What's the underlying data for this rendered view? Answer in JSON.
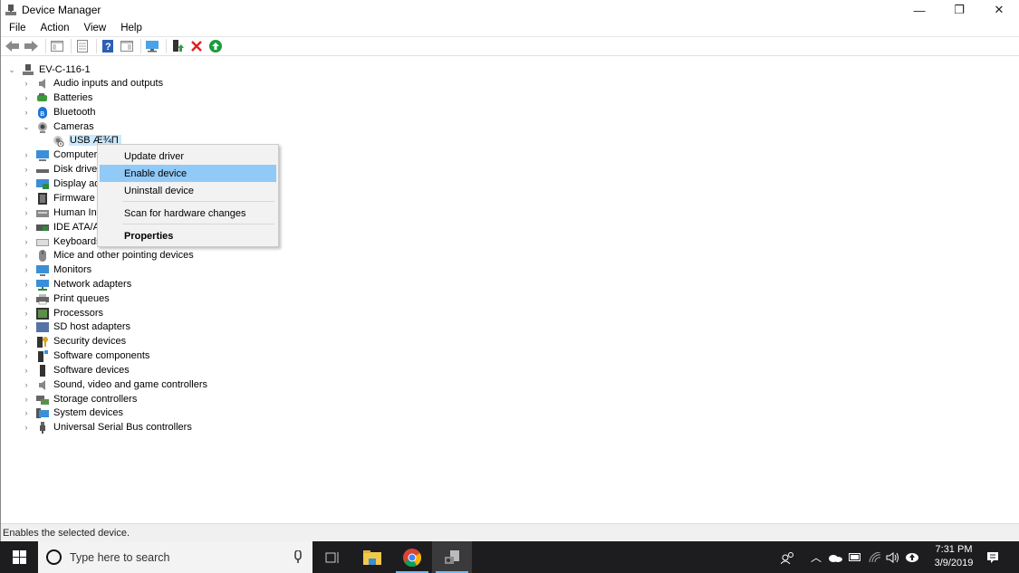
{
  "window": {
    "title": "Device Manager",
    "controls": {
      "minimize": "—",
      "restore": "❐",
      "close": "✕"
    }
  },
  "menu": [
    "File",
    "Action",
    "View",
    "Help"
  ],
  "toolbar": [
    "back-icon",
    "forward-icon",
    "show-hide-console-tree-icon",
    "properties-icon",
    "help-icon",
    "show-hide-action-pane-icon",
    "scan-hardware-icon",
    "update-driver-icon",
    "uninstall-icon",
    "enable-icon"
  ],
  "tree": {
    "root": "EV-C-116-1",
    "categories": [
      {
        "label": "Audio inputs and outputs",
        "icon": "speaker-icon",
        "expanded": false
      },
      {
        "label": "Batteries",
        "icon": "battery-icon",
        "expanded": false
      },
      {
        "label": "Bluetooth",
        "icon": "bluetooth-icon",
        "expanded": false
      },
      {
        "label": "Cameras",
        "icon": "camera-icon",
        "expanded": true,
        "children": [
          {
            "label": "USB Æ¾П",
            "selected": true,
            "disabled": true
          }
        ]
      },
      {
        "label": "Computer",
        "icon": "computer-icon",
        "expanded": false
      },
      {
        "label": "Disk drives",
        "icon": "disk-icon",
        "expanded": false
      },
      {
        "label": "Display adapters",
        "icon": "display-icon",
        "expanded": false
      },
      {
        "label": "Firmware",
        "icon": "firmware-icon",
        "expanded": false
      },
      {
        "label": "Human Interface Devices",
        "icon": "hid-icon",
        "expanded": false
      },
      {
        "label": "IDE ATA/ATAPI controllers",
        "icon": "ide-icon",
        "expanded": false
      },
      {
        "label": "Keyboards",
        "icon": "keyboard-icon",
        "expanded": false
      },
      {
        "label": "Mice and other pointing devices",
        "icon": "mouse-icon",
        "expanded": false
      },
      {
        "label": "Monitors",
        "icon": "monitor-icon",
        "expanded": false
      },
      {
        "label": "Network adapters",
        "icon": "network-icon",
        "expanded": false
      },
      {
        "label": "Print queues",
        "icon": "printer-icon",
        "expanded": false
      },
      {
        "label": "Processors",
        "icon": "processor-icon",
        "expanded": false
      },
      {
        "label": "SD host adapters",
        "icon": "sd-icon",
        "expanded": false
      },
      {
        "label": "Security devices",
        "icon": "security-icon",
        "expanded": false
      },
      {
        "label": "Software components",
        "icon": "software-component-icon",
        "expanded": false
      },
      {
        "label": "Software devices",
        "icon": "software-device-icon",
        "expanded": false
      },
      {
        "label": "Sound, video and game controllers",
        "icon": "sound-icon",
        "expanded": false
      },
      {
        "label": "Storage controllers",
        "icon": "storage-icon",
        "expanded": false
      },
      {
        "label": "System devices",
        "icon": "system-icon",
        "expanded": false
      },
      {
        "label": "Universal Serial Bus controllers",
        "icon": "usb-icon",
        "expanded": false
      }
    ]
  },
  "context_menu": {
    "items": [
      {
        "label": "Update driver",
        "highlighted": false,
        "bold": false
      },
      {
        "label": "Enable device",
        "highlighted": true,
        "bold": false
      },
      {
        "label": "Uninstall device",
        "highlighted": false,
        "bold": false
      },
      {
        "label": "Scan for hardware changes",
        "highlighted": false,
        "bold": false
      },
      {
        "label": "Properties",
        "highlighted": false,
        "bold": true
      }
    ]
  },
  "status": "Enables the selected device.",
  "taskbar": {
    "search_placeholder": "Type here to search",
    "time": "7:31 PM",
    "date": "3/9/2019"
  }
}
